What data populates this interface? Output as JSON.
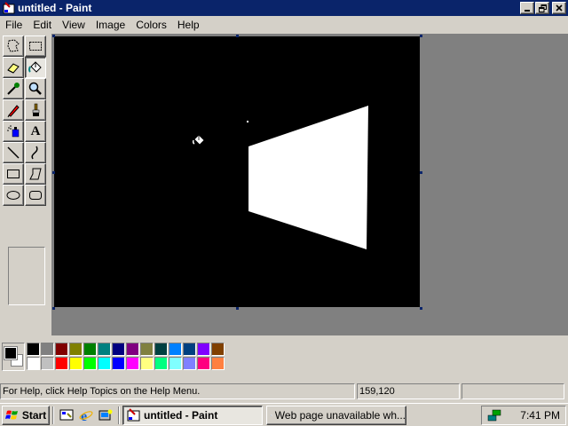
{
  "window": {
    "title": "untitled - Paint"
  },
  "menu": [
    "File",
    "Edit",
    "View",
    "Image",
    "Colors",
    "Help"
  ],
  "tools": [
    {
      "name": "free-form-select-tool",
      "icon": "free-form-select-icon"
    },
    {
      "name": "select-tool",
      "icon": "rectangle-select-icon"
    },
    {
      "name": "eraser-tool",
      "icon": "eraser-icon"
    },
    {
      "name": "fill-tool",
      "icon": "paint-bucket-icon",
      "selected": true
    },
    {
      "name": "pick-color-tool",
      "icon": "eyedropper-icon"
    },
    {
      "name": "magnifier-tool",
      "icon": "magnifier-icon"
    },
    {
      "name": "pencil-tool",
      "icon": "pencil-icon"
    },
    {
      "name": "brush-tool",
      "icon": "brush-icon"
    },
    {
      "name": "airbrush-tool",
      "icon": "airbrush-icon"
    },
    {
      "name": "text-tool",
      "icon": "text-icon",
      "glyph": "A"
    },
    {
      "name": "line-tool",
      "icon": "line-icon"
    },
    {
      "name": "curve-tool",
      "icon": "curve-icon"
    },
    {
      "name": "rectangle-tool",
      "icon": "rectangle-icon"
    },
    {
      "name": "polygon-tool",
      "icon": "polygon-icon"
    },
    {
      "name": "ellipse-tool",
      "icon": "ellipse-icon"
    },
    {
      "name": "rounded-rectangle-tool",
      "icon": "rounded-rectangle-icon"
    }
  ],
  "colors": {
    "foreground": "#000000",
    "background": "#ffffff",
    "palette_top": [
      "#000000",
      "#808080",
      "#800000",
      "#808000",
      "#008000",
      "#008080",
      "#000080",
      "#800080",
      "#808040",
      "#004040",
      "#0080ff",
      "#004080",
      "#8000ff",
      "#804000"
    ],
    "palette_bottom": [
      "#ffffff",
      "#c0c0c0",
      "#ff0000",
      "#ffff00",
      "#00ff00",
      "#00ffff",
      "#0000ff",
      "#ff00ff",
      "#ffff80",
      "#00ff80",
      "#80ffff",
      "#8080ff",
      "#ff0080",
      "#ff8040"
    ]
  },
  "canvas": {
    "background": "#000000",
    "shape_color": "#ffffff"
  },
  "status": {
    "help_text": "For Help, click Help Topics on the Help Menu.",
    "coords": "159,120",
    "size": ""
  },
  "taskbar": {
    "start_label": "Start",
    "quick_launch": [
      "desktop-icon",
      "internet-explorer-icon",
      "channels-icon"
    ],
    "tasks": [
      {
        "label": "untitled - Paint",
        "icon": "paint-icon",
        "active": true
      },
      {
        "label": "Web page unavailable wh...",
        "icon": "internet-explorer-icon",
        "active": false
      }
    ],
    "clock": "7:41 PM"
  }
}
